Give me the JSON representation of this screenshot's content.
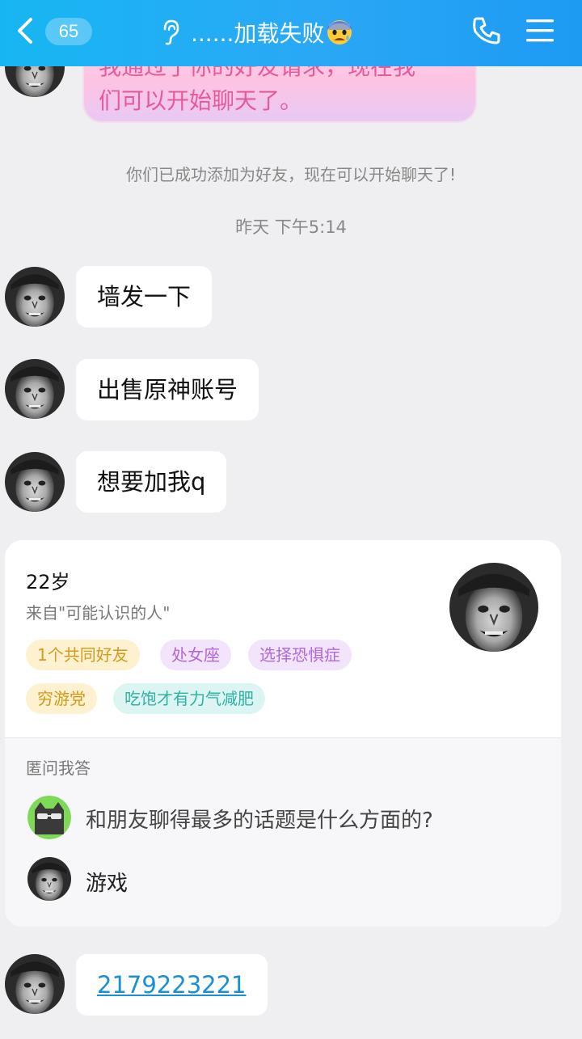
{
  "header": {
    "unread_count": "65",
    "title": "......加载失败",
    "icons": [
      "back-icon",
      "ear-icon",
      "anxious-face-emoji-icon",
      "phone-icon",
      "menu-icon"
    ]
  },
  "messages": {
    "top_bubble_text": "我通过了你的好友请求，现在我\n们可以开始聊天了。",
    "system_notice": "你们已成功添加为好友，现在可以开始聊天了!",
    "timestamp": "昨天 下午5:14",
    "bubble1": "墙发一下",
    "bubble2": "出售原神账号",
    "bubble3": "想要加我q",
    "last_bubble_link": "2179223221"
  },
  "profile_card": {
    "age": "22岁",
    "source": "来自\"可能认识的人\"",
    "tags": [
      {
        "text": "1个共同好友",
        "color": "yellow"
      },
      {
        "text": "处女座",
        "color": "purple"
      },
      {
        "text": "选择恐惧症",
        "color": "purple"
      },
      {
        "text": "穷游党",
        "color": "yellow"
      },
      {
        "text": "吃饱才有力气减肥",
        "color": "green"
      }
    ],
    "qa_heading": "匿问我答",
    "question": "和朋友聊得最多的话题是什么方面的?",
    "answer": "游戏"
  },
  "colors": {
    "header_gradient_start": "#17b6f2",
    "header_gradient_end": "#1d9af3",
    "background": "#efeff1",
    "link": "#1a8fd6",
    "pink_text": "#e65a9c"
  }
}
